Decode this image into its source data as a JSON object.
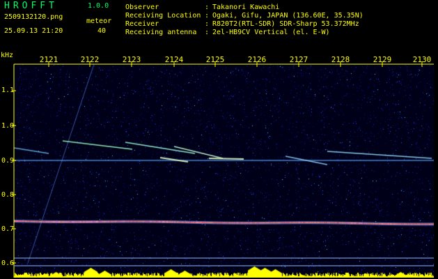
{
  "brand": {
    "name": "HROFFT",
    "version": "1.0.0"
  },
  "file": {
    "name": "2509132120.png",
    "datetime": "25.09.13 21:20"
  },
  "meteor": {
    "label": "meteor",
    "count": "40"
  },
  "info": [
    {
      "key": "Observer",
      "sep": ":",
      "value": "Takanori Kawachi"
    },
    {
      "key": "Receiving Location",
      "sep": ":",
      "value": "Ogaki, Gifu, JAPAN (136.60E, 35.35N)"
    },
    {
      "key": "Receiver",
      "sep": ":",
      "value": "R820T2(RTL-SDR) SDR-Sharp 53.372MHz"
    },
    {
      "key": "Receiving antenna",
      "sep": ":",
      "value": "2el-HB9CV Vertical (el. E-W)"
    }
  ],
  "axis": {
    "y_unit": "kHz",
    "x_ticks": [
      "2121",
      "2122",
      "2123",
      "2124",
      "2125",
      "2126",
      "2127",
      "2128",
      "2129",
      "2130"
    ],
    "y_ticks": [
      "1.1",
      "1.0",
      "0.9",
      "0.8",
      "0.7",
      "0.6"
    ]
  },
  "colors": {
    "header_text": "#00ff66",
    "axis_text": "#ffff00",
    "background": "#000010",
    "carrier": "#ff5a5a",
    "bottom_bars": "#ffff00"
  }
}
